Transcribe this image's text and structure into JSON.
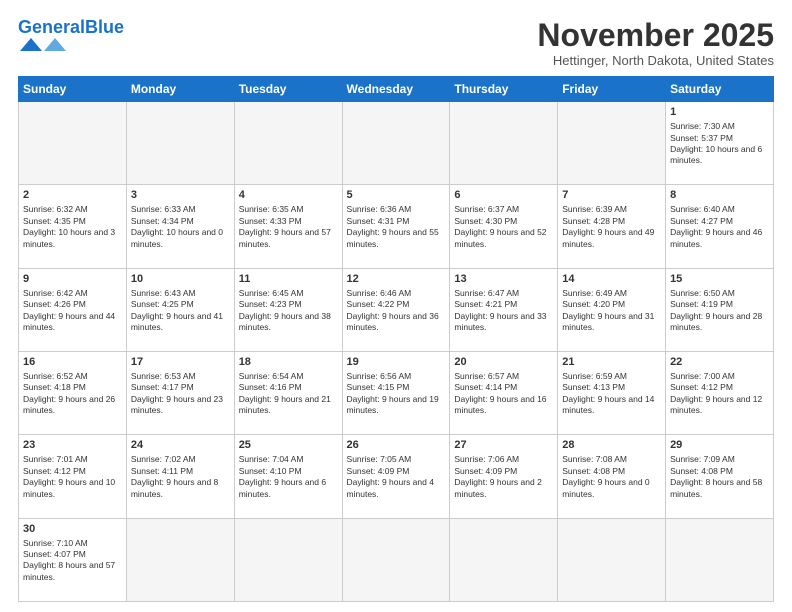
{
  "header": {
    "logo_general": "General",
    "logo_blue": "Blue",
    "month_title": "November 2025",
    "subtitle": "Hettinger, North Dakota, United States"
  },
  "days_of_week": [
    "Sunday",
    "Monday",
    "Tuesday",
    "Wednesday",
    "Thursday",
    "Friday",
    "Saturday"
  ],
  "weeks": [
    [
      {
        "day": "",
        "info": ""
      },
      {
        "day": "",
        "info": ""
      },
      {
        "day": "",
        "info": ""
      },
      {
        "day": "",
        "info": ""
      },
      {
        "day": "",
        "info": ""
      },
      {
        "day": "",
        "info": ""
      },
      {
        "day": "1",
        "info": "Sunrise: 7:30 AM\nSunset: 5:37 PM\nDaylight: 10 hours and 6 minutes."
      }
    ],
    [
      {
        "day": "2",
        "info": "Sunrise: 6:32 AM\nSunset: 4:35 PM\nDaylight: 10 hours and 3 minutes."
      },
      {
        "day": "3",
        "info": "Sunrise: 6:33 AM\nSunset: 4:34 PM\nDaylight: 10 hours and 0 minutes."
      },
      {
        "day": "4",
        "info": "Sunrise: 6:35 AM\nSunset: 4:33 PM\nDaylight: 9 hours and 57 minutes."
      },
      {
        "day": "5",
        "info": "Sunrise: 6:36 AM\nSunset: 4:31 PM\nDaylight: 9 hours and 55 minutes."
      },
      {
        "day": "6",
        "info": "Sunrise: 6:37 AM\nSunset: 4:30 PM\nDaylight: 9 hours and 52 minutes."
      },
      {
        "day": "7",
        "info": "Sunrise: 6:39 AM\nSunset: 4:28 PM\nDaylight: 9 hours and 49 minutes."
      },
      {
        "day": "8",
        "info": "Sunrise: 6:40 AM\nSunset: 4:27 PM\nDaylight: 9 hours and 46 minutes."
      }
    ],
    [
      {
        "day": "9",
        "info": "Sunrise: 6:42 AM\nSunset: 4:26 PM\nDaylight: 9 hours and 44 minutes."
      },
      {
        "day": "10",
        "info": "Sunrise: 6:43 AM\nSunset: 4:25 PM\nDaylight: 9 hours and 41 minutes."
      },
      {
        "day": "11",
        "info": "Sunrise: 6:45 AM\nSunset: 4:23 PM\nDaylight: 9 hours and 38 minutes."
      },
      {
        "day": "12",
        "info": "Sunrise: 6:46 AM\nSunset: 4:22 PM\nDaylight: 9 hours and 36 minutes."
      },
      {
        "day": "13",
        "info": "Sunrise: 6:47 AM\nSunset: 4:21 PM\nDaylight: 9 hours and 33 minutes."
      },
      {
        "day": "14",
        "info": "Sunrise: 6:49 AM\nSunset: 4:20 PM\nDaylight: 9 hours and 31 minutes."
      },
      {
        "day": "15",
        "info": "Sunrise: 6:50 AM\nSunset: 4:19 PM\nDaylight: 9 hours and 28 minutes."
      }
    ],
    [
      {
        "day": "16",
        "info": "Sunrise: 6:52 AM\nSunset: 4:18 PM\nDaylight: 9 hours and 26 minutes."
      },
      {
        "day": "17",
        "info": "Sunrise: 6:53 AM\nSunset: 4:17 PM\nDaylight: 9 hours and 23 minutes."
      },
      {
        "day": "18",
        "info": "Sunrise: 6:54 AM\nSunset: 4:16 PM\nDaylight: 9 hours and 21 minutes."
      },
      {
        "day": "19",
        "info": "Sunrise: 6:56 AM\nSunset: 4:15 PM\nDaylight: 9 hours and 19 minutes."
      },
      {
        "day": "20",
        "info": "Sunrise: 6:57 AM\nSunset: 4:14 PM\nDaylight: 9 hours and 16 minutes."
      },
      {
        "day": "21",
        "info": "Sunrise: 6:59 AM\nSunset: 4:13 PM\nDaylight: 9 hours and 14 minutes."
      },
      {
        "day": "22",
        "info": "Sunrise: 7:00 AM\nSunset: 4:12 PM\nDaylight: 9 hours and 12 minutes."
      }
    ],
    [
      {
        "day": "23",
        "info": "Sunrise: 7:01 AM\nSunset: 4:12 PM\nDaylight: 9 hours and 10 minutes."
      },
      {
        "day": "24",
        "info": "Sunrise: 7:02 AM\nSunset: 4:11 PM\nDaylight: 9 hours and 8 minutes."
      },
      {
        "day": "25",
        "info": "Sunrise: 7:04 AM\nSunset: 4:10 PM\nDaylight: 9 hours and 6 minutes."
      },
      {
        "day": "26",
        "info": "Sunrise: 7:05 AM\nSunset: 4:09 PM\nDaylight: 9 hours and 4 minutes."
      },
      {
        "day": "27",
        "info": "Sunrise: 7:06 AM\nSunset: 4:09 PM\nDaylight: 9 hours and 2 minutes."
      },
      {
        "day": "28",
        "info": "Sunrise: 7:08 AM\nSunset: 4:08 PM\nDaylight: 9 hours and 0 minutes."
      },
      {
        "day": "29",
        "info": "Sunrise: 7:09 AM\nSunset: 4:08 PM\nDaylight: 8 hours and 58 minutes."
      }
    ],
    [
      {
        "day": "30",
        "info": "Sunrise: 7:10 AM\nSunset: 4:07 PM\nDaylight: 8 hours and 57 minutes."
      },
      {
        "day": "",
        "info": ""
      },
      {
        "day": "",
        "info": ""
      },
      {
        "day": "",
        "info": ""
      },
      {
        "day": "",
        "info": ""
      },
      {
        "day": "",
        "info": ""
      },
      {
        "day": "",
        "info": ""
      }
    ]
  ]
}
